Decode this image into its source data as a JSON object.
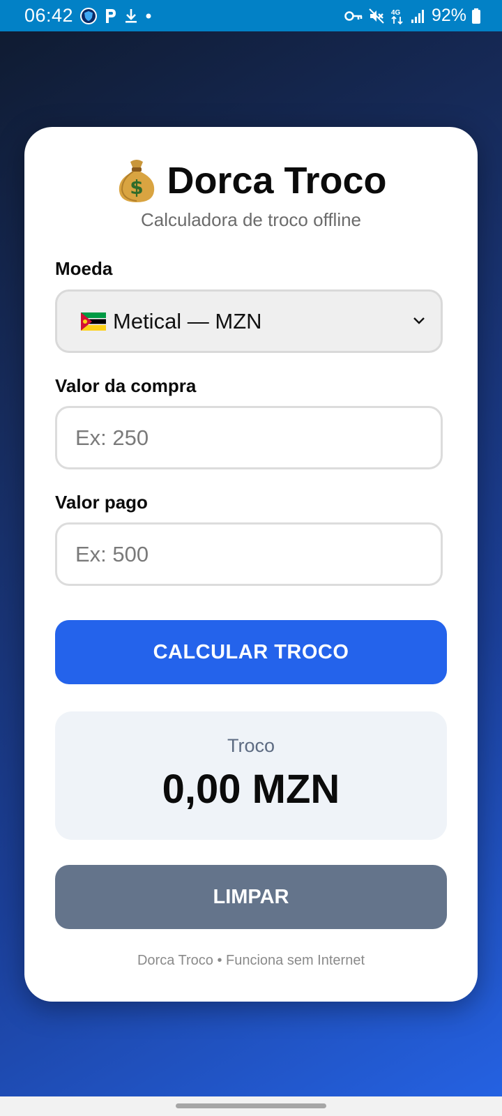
{
  "status_bar": {
    "time": "06:42",
    "battery": "92%",
    "left_icons": [
      "shield-app-icon",
      "p-app-icon",
      "download-icon",
      "dot-icon"
    ],
    "right_icons": [
      "key-icon",
      "mute-icon",
      "network-4g-icon",
      "signal-icon",
      "battery-icon"
    ]
  },
  "header": {
    "emoji": "money-bag-icon",
    "title": "Dorca Troco",
    "subtitle": "Calculadora de troco offline"
  },
  "form": {
    "currency_label": "Moeda",
    "currency_value": "Metical — MZN",
    "currency_flag": "mozambique-flag-icon",
    "purchase_label": "Valor da compra",
    "purchase_placeholder": "Ex: 250",
    "paid_label": "Valor pago",
    "paid_placeholder": "Ex: 500"
  },
  "buttons": {
    "calculate": "CALCULAR TROCO",
    "clear": "LIMPAR"
  },
  "result": {
    "label": "Troco",
    "value": "0,00 MZN"
  },
  "footer": "Dorca Troco • Funciona sem Internet",
  "colors": {
    "status_bar": "#0281c6",
    "primary_button": "#2463eb",
    "secondary_button": "#64748b",
    "result_background": "#eff3f8"
  }
}
